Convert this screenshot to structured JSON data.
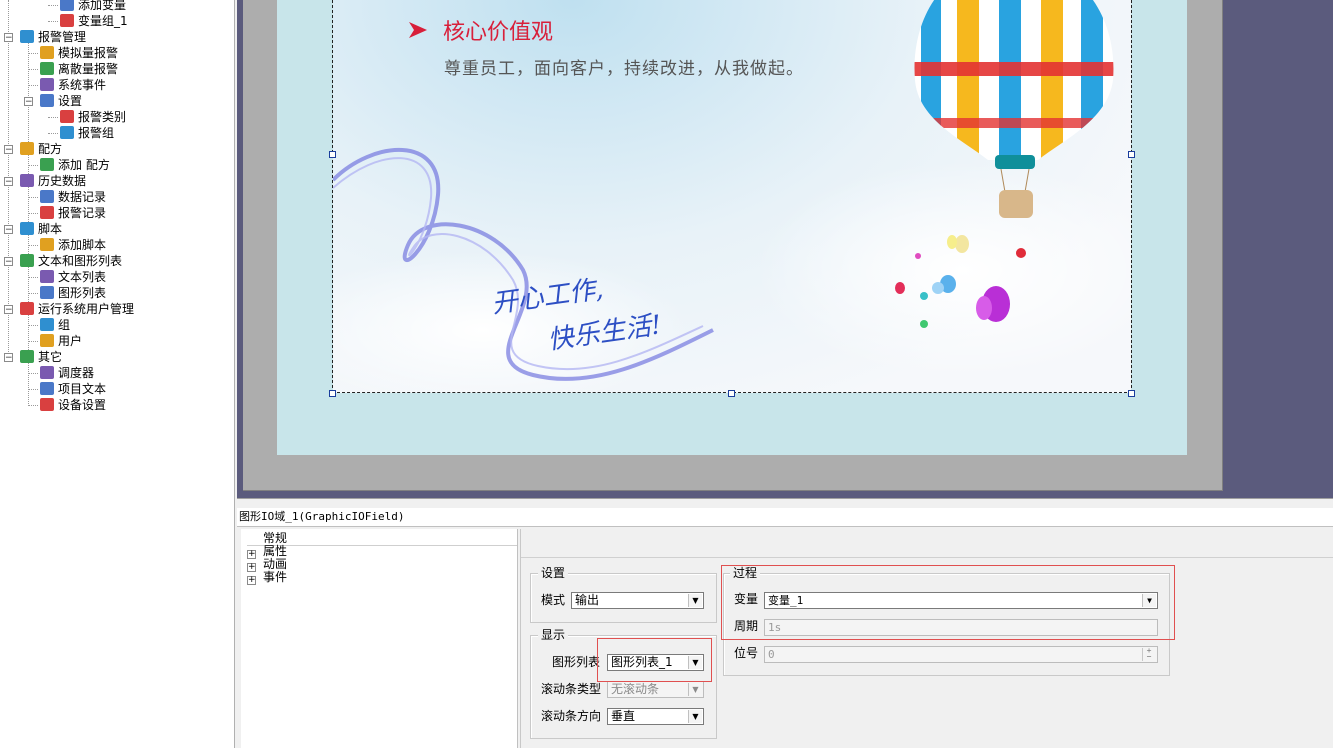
{
  "tree": {
    "items": [
      {
        "label": "添加变量",
        "level": 2
      },
      {
        "label": "变量组_1",
        "level": 2
      },
      {
        "label": "报警管理",
        "level": 0
      },
      {
        "label": "模拟量报警",
        "level": 1
      },
      {
        "label": "离散量报警",
        "level": 1
      },
      {
        "label": "系统事件",
        "level": 1
      },
      {
        "label": "设置",
        "level": 1
      },
      {
        "label": "报警类别",
        "level": 2
      },
      {
        "label": "报警组",
        "level": 2
      },
      {
        "label": "配方",
        "level": 0
      },
      {
        "label": "添加 配方",
        "level": 1
      },
      {
        "label": "历史数据",
        "level": 0
      },
      {
        "label": "数据记录",
        "level": 1
      },
      {
        "label": "报警记录",
        "level": 1
      },
      {
        "label": "脚本",
        "level": 0
      },
      {
        "label": "添加脚本",
        "level": 1
      },
      {
        "label": "文本和图形列表",
        "level": 0
      },
      {
        "label": "文本列表",
        "level": 1
      },
      {
        "label": "图形列表",
        "level": 1
      },
      {
        "label": "运行系统用户管理",
        "level": 0
      },
      {
        "label": "组",
        "level": 1
      },
      {
        "label": "用户",
        "level": 1
      },
      {
        "label": "其它",
        "level": 0
      },
      {
        "label": "调度器",
        "level": 1
      },
      {
        "label": "项目文本",
        "level": 1
      },
      {
        "label": "设备设置",
        "level": 1
      }
    ]
  },
  "canvas": {
    "heading": "核心价值观",
    "subheading": "尊重员工，面向客户，持续改进，从我做起。",
    "slogan_line1": "开心工作,",
    "slogan_line2": "快乐生活!"
  },
  "panel": {
    "title": "图形IO域_1(GraphicIOField)",
    "nav": [
      {
        "label": "常规",
        "expandable": false
      },
      {
        "label": "属性",
        "expandable": true
      },
      {
        "label": "动画",
        "expandable": true
      },
      {
        "label": "事件",
        "expandable": true
      }
    ],
    "settings": {
      "group_label": "设置",
      "mode_label": "模式",
      "mode_value": "输出"
    },
    "display": {
      "group_label": "显示",
      "graphic_list_label": "图形列表",
      "graphic_list_value": "图形列表_1",
      "scrollbar_type_label": "滚动条类型",
      "scrollbar_type_value": "无滚动条",
      "scrollbar_dir_label": "滚动条方向",
      "scrollbar_dir_value": "垂直"
    },
    "process": {
      "group_label": "过程",
      "variable_label": "变量",
      "variable_value": "变量_1",
      "cycle_label": "周期",
      "cycle_value": "1s",
      "bit_label": "位号",
      "bit_value": "0"
    }
  },
  "colors": {
    "heading": "#d81f3a",
    "workspace": "#5b5b7d",
    "screen_bg": "#c8e5ea",
    "highlight_box": "#e05050"
  }
}
